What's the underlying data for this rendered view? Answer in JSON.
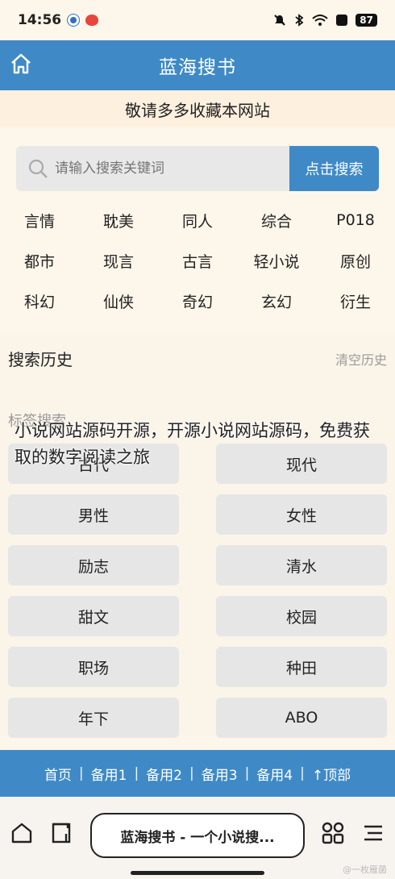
{
  "status": {
    "time": "14:56",
    "battery": "87"
  },
  "header": {
    "title": "蓝海搜书"
  },
  "notice": "敬请多多收藏本网站",
  "search": {
    "placeholder": "请输入搜索关键词",
    "button": "点击搜索"
  },
  "categories": [
    [
      "言情",
      "耽美",
      "同人",
      "综合",
      "P018"
    ],
    [
      "都市",
      "现言",
      "古言",
      "轻小说",
      "原创"
    ],
    [
      "科幻",
      "仙侠",
      "奇幻",
      "玄幻",
      "衍生"
    ]
  ],
  "history": {
    "title": "搜索历史",
    "clear": "清空历史"
  },
  "tag_search": {
    "title": "标签搜索",
    "tags": [
      "古代",
      "现代",
      "男性",
      "女性",
      "励志",
      "清水",
      "甜文",
      "校园",
      "职场",
      "种田",
      "年下",
      "ABO"
    ]
  },
  "overlay_caption": "小说网站源码开源，开源小说网站源码，免费获取的数字阅读之旅",
  "footer_nav": [
    "首页",
    "备用1",
    "备用2",
    "备用3",
    "备用4",
    "↑顶部"
  ],
  "browser": {
    "url_title": "蓝海搜书 - 一个小说搜..."
  },
  "watermark": "@一枚雁菌",
  "colors": {
    "accent": "#3f8ac6",
    "background": "#fdf6ea"
  }
}
